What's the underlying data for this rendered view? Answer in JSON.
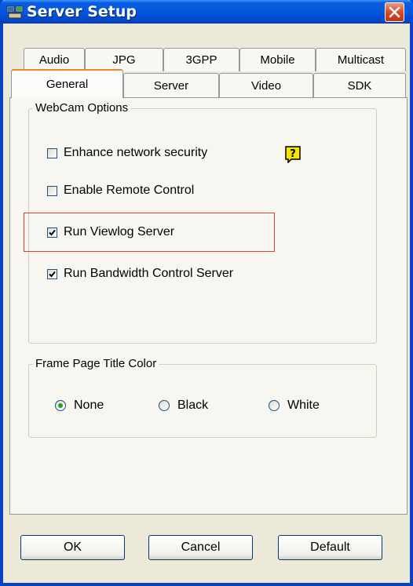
{
  "window": {
    "title": "Server Setup"
  },
  "tabs": {
    "row1": [
      "Audio",
      "JPG",
      "3GPP",
      "Mobile",
      "Multicast"
    ],
    "row2": [
      "General",
      "Server",
      "Video",
      "SDK"
    ],
    "active": "General"
  },
  "webcam_options": {
    "legend": "WebCam Options",
    "items": [
      {
        "label": "Enhance network security",
        "checked": false
      },
      {
        "label": "Enable Remote Control",
        "checked": false
      },
      {
        "label": "Run Viewlog Server",
        "checked": true
      },
      {
        "label": "Run Bandwidth Control Server",
        "checked": true
      }
    ],
    "help_icon": "question-icon"
  },
  "frame_title_color": {
    "legend": "Frame Page Title Color",
    "options": [
      {
        "label": "None",
        "selected": true
      },
      {
        "label": "Black",
        "selected": false
      },
      {
        "label": "White",
        "selected": false
      }
    ]
  },
  "buttons": {
    "ok": "OK",
    "cancel": "Cancel",
    "default": "Default"
  },
  "colors": {
    "titlebar": "#0458e0",
    "highlight": "#e03a3a",
    "active_tab_accent": "#e68b2c"
  }
}
